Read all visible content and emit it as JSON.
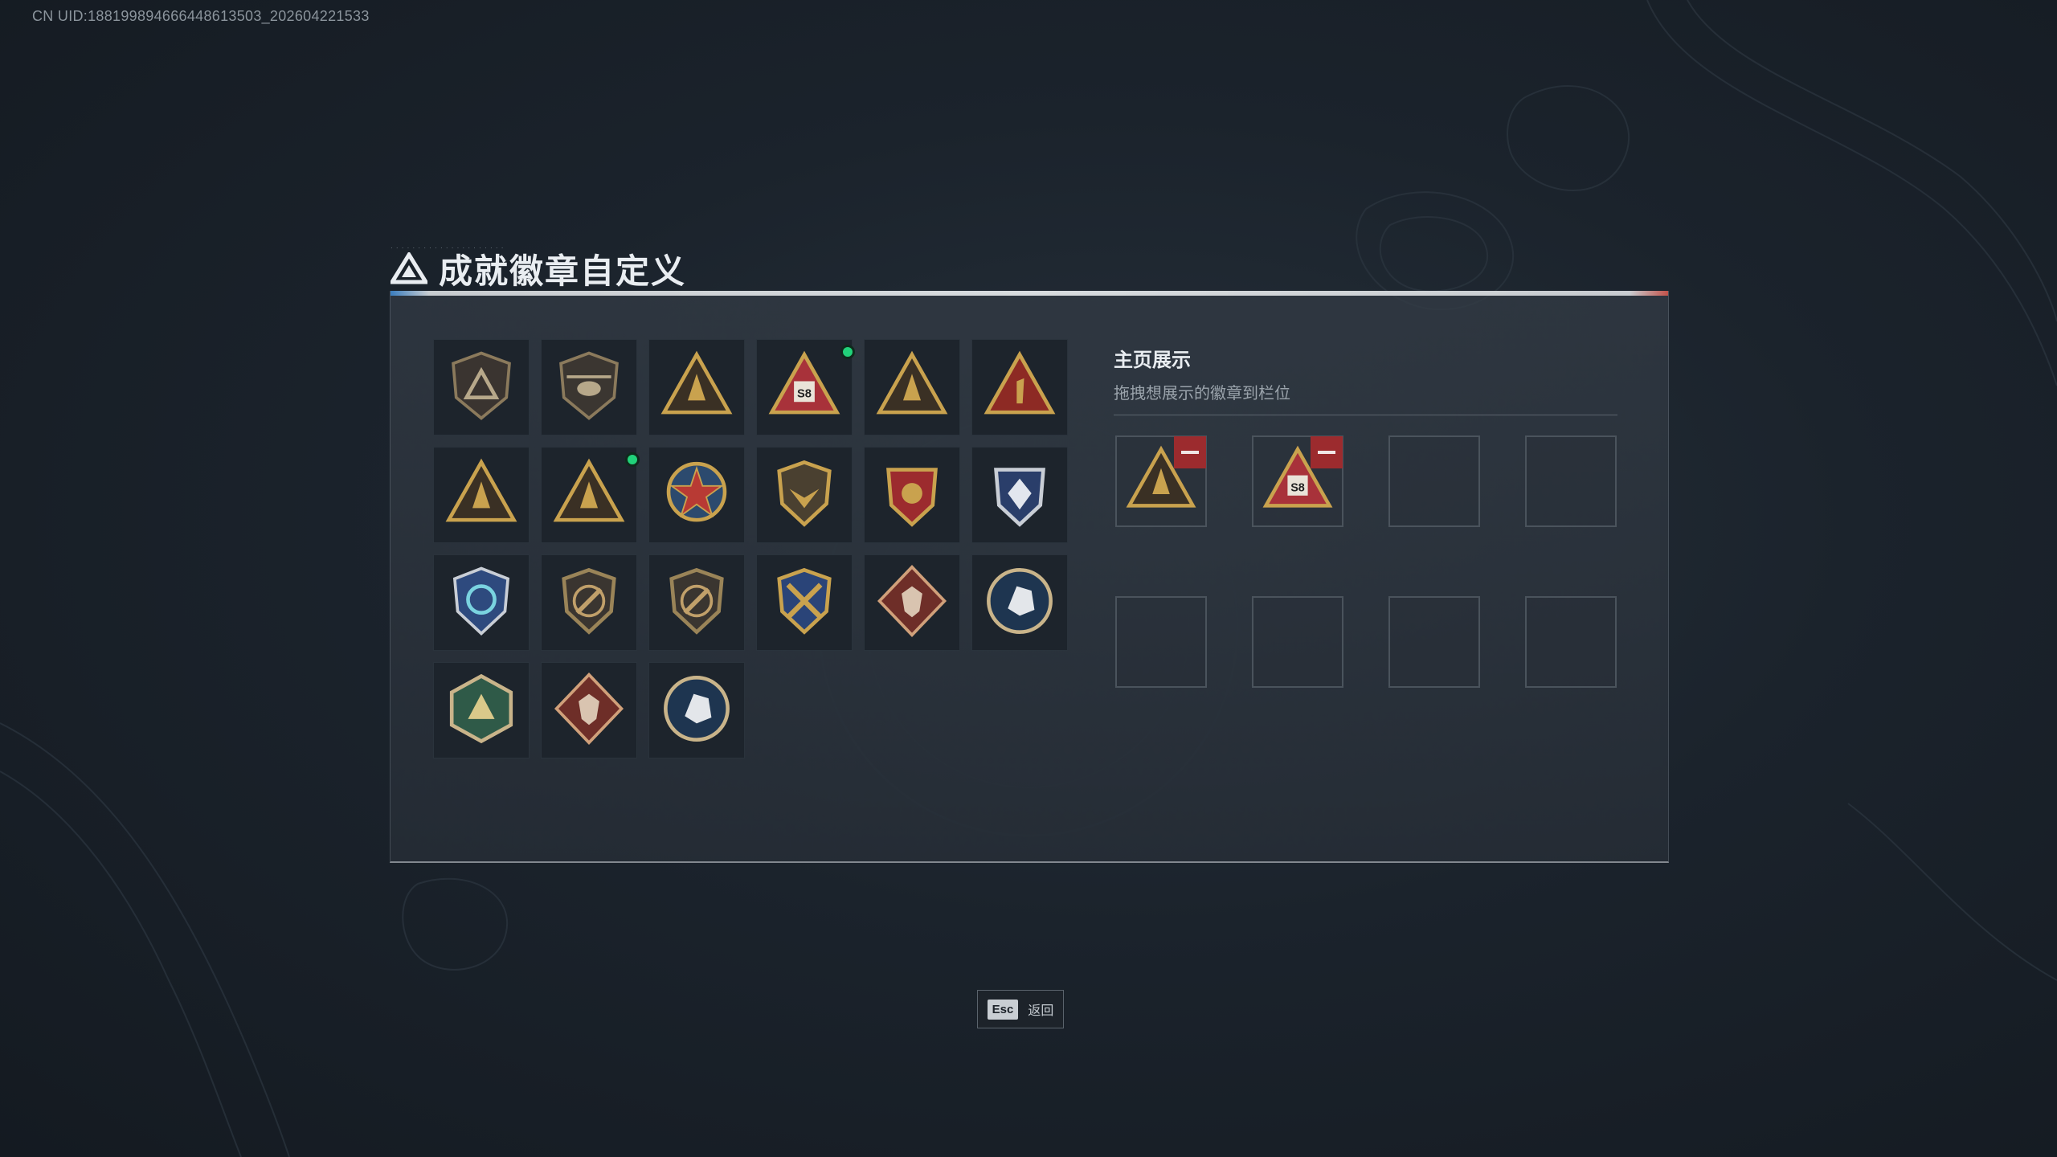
{
  "uid_text": "CN UID:188199894666448613503_202604221533",
  "title": "成就徽章自定义",
  "showcase": {
    "title": "主页展示",
    "subtitle": "拖拽想展示的徽章到栏位"
  },
  "footer": {
    "esc_key": "Esc",
    "back_label": "返回"
  },
  "badges": [
    {
      "icon": "triangle-shield-badge-icon",
      "new": false
    },
    {
      "icon": "helicopter-shield-badge-icon",
      "new": false
    },
    {
      "icon": "gold-triangle-crate-badge-icon",
      "new": false
    },
    {
      "icon": "s8-triangle-badge-icon",
      "new": true,
      "label": "S8"
    },
    {
      "icon": "gold-triangle-ship-badge-icon",
      "new": false
    },
    {
      "icon": "red-triangle-number-one-badge-icon",
      "new": false,
      "label": "1"
    },
    {
      "icon": "gold-triangle-soldier-badge-icon",
      "new": false
    },
    {
      "icon": "gold-triangle-rocket-badge-icon",
      "new": true
    },
    {
      "icon": "red-star-medal-badge-icon",
      "new": false
    },
    {
      "icon": "gold-wings-shield-badge-icon",
      "new": false
    },
    {
      "icon": "red-star-crest-badge-icon",
      "new": false
    },
    {
      "icon": "blue-diamond-crest-badge-icon",
      "new": false
    },
    {
      "icon": "blue-crosshair-shield-badge-icon",
      "new": false
    },
    {
      "icon": "bronze-rifle-shield-badge-icon",
      "new": false
    },
    {
      "icon": "bronze-rifle-shield-dark-badge-icon",
      "new": false
    },
    {
      "icon": "gold-crossed-swords-badge-icon",
      "new": false
    },
    {
      "icon": "red-diamond-wolf-badge-icon",
      "new": false
    },
    {
      "icon": "blue-eagle-circle-badge-icon",
      "new": false
    },
    {
      "icon": "green-dragon-hexagon-badge-icon",
      "new": false
    },
    {
      "icon": "red-diamond-dragon-badge-icon",
      "new": false
    },
    {
      "icon": "blue-lynx-circle-badge-icon",
      "new": false
    }
  ],
  "slots": [
    {
      "filled": true,
      "icon": "gold-triangle-rocket-badge-icon"
    },
    {
      "filled": true,
      "icon": "s8-triangle-badge-icon",
      "label": "S8"
    },
    {
      "filled": false
    },
    {
      "filled": false
    },
    {
      "filled": false
    },
    {
      "filled": false
    },
    {
      "filled": false
    },
    {
      "filled": false
    }
  ],
  "colors": {
    "gold": "#c9a24e",
    "red": "#8d2a24",
    "new_indicator": "#21d27a",
    "remove": "#9c2b2e"
  }
}
